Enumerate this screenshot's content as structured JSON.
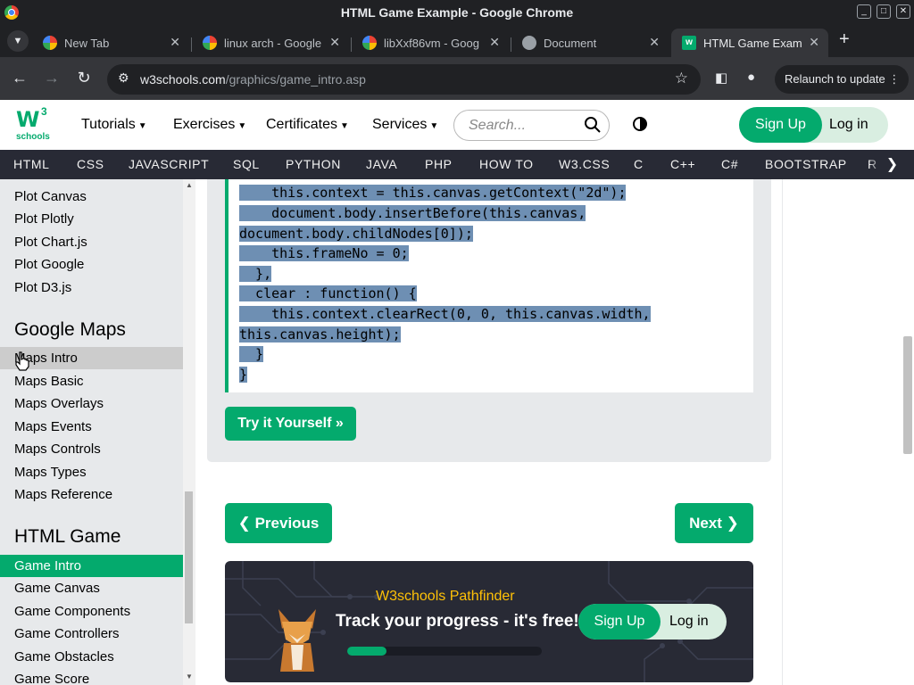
{
  "window": {
    "title": "HTML Game Example - Google Chrome",
    "buttons": [
      "_",
      "□",
      "✕"
    ]
  },
  "tabs": [
    {
      "title": "New Tab",
      "icon": "chrome-icon",
      "active": false
    },
    {
      "title": "linux arch - Google",
      "icon": "google-icon",
      "active": false
    },
    {
      "title": "libXxf86vm - Goog",
      "icon": "google-icon",
      "active": false
    },
    {
      "title": "Document",
      "icon": "globe-icon",
      "active": false
    },
    {
      "title": "HTML Game Exam",
      "icon": "w3schools-icon",
      "active": true
    }
  ],
  "toolbar": {
    "url_host": "w3schools.com",
    "url_path": "/graphics/game_intro.asp",
    "relaunch_label": "Relaunch to update"
  },
  "topnav": {
    "logo_mark": "W",
    "logo_sup": "3",
    "logo_word": "schools",
    "menus": [
      "Tutorials",
      "Exercises",
      "Certificates",
      "Services"
    ],
    "search_placeholder": "Search...",
    "signup_label": "Sign Up",
    "login_label": "Log in"
  },
  "langbar": [
    "HTML",
    "CSS",
    "JAVASCRIPT",
    "SQL",
    "PYTHON",
    "JAVA",
    "PHP",
    "HOW TO",
    "W3.CSS",
    "C",
    "C++",
    "C#",
    "BOOTSTRAP",
    "R"
  ],
  "sidebar": {
    "plot_items": [
      "Plot Canvas",
      "Plot Plotly",
      "Plot Chart.js",
      "Plot Google",
      "Plot D3.js"
    ],
    "maps_heading": "Google Maps",
    "maps_items": [
      "Maps Intro",
      "Maps Basic",
      "Maps Overlays",
      "Maps Events",
      "Maps Controls",
      "Maps Types",
      "Maps Reference"
    ],
    "game_heading": "HTML Game",
    "game_items": [
      "Game Intro",
      "Game Canvas",
      "Game Components",
      "Game Controllers",
      "Game Obstacles",
      "Game Score"
    ]
  },
  "code": {
    "lines": [
      "    this.context = this.canvas.getContext(\"2d\");",
      "    document.body.insertBefore(this.canvas,",
      "document.body.childNodes[0]);",
      "    this.frameNo = 0;",
      "  },",
      "  clear : function() {",
      "    this.context.clearRect(0, 0, this.canvas.width,",
      "this.canvas.height);",
      "  }",
      "}"
    ]
  },
  "main": {
    "try_label": "Try it Yourself »",
    "prev_label": "❮ Previous",
    "next_label": "Next ❯"
  },
  "pathfinder": {
    "title": "W3schools Pathfinder",
    "subtitle": "Track your progress - it's free!",
    "signup_label": "Sign Up",
    "login_label": "Log in",
    "progress": 0.2
  },
  "colors": {
    "accent": "#04aa6d",
    "dark": "#282a35",
    "sidebar_bg": "#e7e9eb",
    "selection": "#6e8fb3",
    "pathfinder_title": "#ffc107"
  }
}
